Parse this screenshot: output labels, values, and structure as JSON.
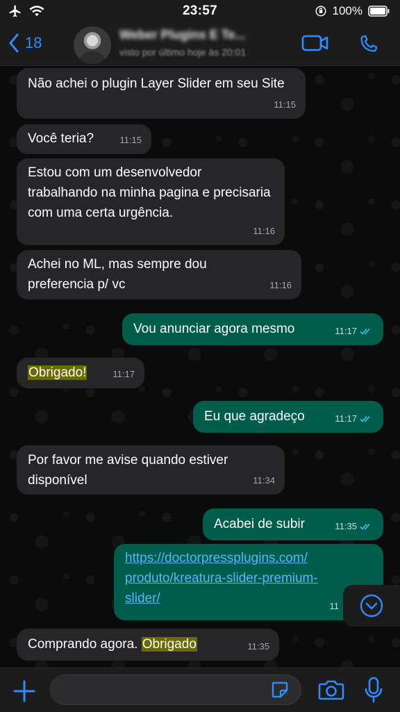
{
  "status_bar": {
    "time": "23:57",
    "battery": "100%"
  },
  "header": {
    "back_count": "18",
    "contact_name": "Weber Plugins E Te...",
    "contact_status": "visto por último hoje às 20:01"
  },
  "messages": [
    {
      "dir": "in",
      "text": "Não achei o plugin Layer Slider em seu Site",
      "time": "11:15"
    },
    {
      "dir": "in",
      "text": "Você teria?",
      "time": "11:15"
    },
    {
      "dir": "in",
      "text": "Estou com um desenvolvedor trabalhando na minha pagina e precisaria com uma certa urgência.",
      "time": "11:16"
    },
    {
      "dir": "in",
      "text": "Achei no ML, mas sempre dou preferencia p/ vc",
      "time": "11:16"
    },
    {
      "dir": "out",
      "text": "Vou anunciar agora mesmo",
      "time": "11:17"
    },
    {
      "dir": "in",
      "text": "Obrigado!",
      "time": "11:17"
    },
    {
      "dir": "out",
      "text": "Eu que agradeço",
      "time": "11:17"
    },
    {
      "dir": "in",
      "text": "Por favor me avise quando estiver disponível",
      "time": "11:34"
    },
    {
      "dir": "out",
      "text": "Acabei de subir",
      "time": "11:35"
    },
    {
      "dir": "out",
      "link": "https://doctorpressplugins.com/produto/kreatura-slider-premium-slider/",
      "link_lines": [
        "https://doctorpressplugins.com/",
        "produto/kreatura-slider-premium-",
        "slider/"
      ],
      "time": "11"
    },
    {
      "dir": "in",
      "text_before": "Comprando agora. ",
      "highlight": "Obrigado",
      "time": "11:35"
    }
  ],
  "colors": {
    "accent": "#2f8cff",
    "incoming_bubble": "#262628",
    "outgoing_bubble": "#005c4b",
    "highlight": "#6b6a00",
    "link": "#55b6ff",
    "read_ticks": "#53bdeb"
  },
  "icons": {
    "airplane": "airplane-icon",
    "wifi": "wifi-icon",
    "video": "video-call-icon",
    "phone": "phone-icon",
    "scroll_down": "chevron-down-circle-icon",
    "plus": "plus-icon",
    "sticker": "sticker-icon",
    "camera": "camera-icon",
    "mic": "microphone-icon"
  }
}
